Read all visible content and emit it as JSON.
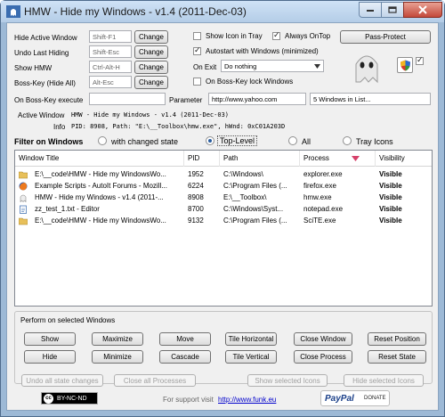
{
  "window": {
    "title": "HMW - Hide my Windows - v1.4 (2011-Dec-03)"
  },
  "hotkeys": [
    {
      "label": "Hide Active Window",
      "value": "Shift-F1",
      "button": "Change"
    },
    {
      "label": "Undo Last Hiding",
      "value": "Shift-Esc",
      "button": "Change"
    },
    {
      "label": "Show HMW",
      "value": "Ctrl-Alt-H",
      "button": "Change"
    },
    {
      "label": "Boss-Key (Hide All)",
      "value": "Alt-Esc",
      "button": "Change"
    }
  ],
  "options": {
    "show_icon_in_tray": {
      "label": "Show Icon in Tray",
      "checked": false
    },
    "always_on_top": {
      "label": "Always OnTop",
      "checked": true
    },
    "autostart": {
      "label": "Autostart with Windows (minimized)",
      "checked": true
    },
    "on_exit_label": "On Exit",
    "on_exit_value": "Do nothing",
    "boss_key_lock": {
      "label": "On Boss-Key lock Windows",
      "checked": false
    },
    "pass_protect": "Pass-Protect"
  },
  "boss_execute": {
    "label": "On Boss-Key execute",
    "value": "",
    "parameter_label": "Parameter",
    "parameter_value": "http://www.yahoo.com",
    "window_count": "5 Windows in List..."
  },
  "active_window": {
    "label": "Active Window",
    "value": "HMW - Hide my Windows - v1.4 (2011-Dec-03)",
    "info_label": "Info",
    "info_value": "PID: 8908, Path: \"E:\\__Toolbox\\hmw.exe\", hWnd: 0xC01A203D"
  },
  "filter": {
    "label": "Filter on Windows",
    "options": [
      "with changed state",
      "Top-Level",
      "All",
      "Tray Icons"
    ],
    "selected": "Top-Level"
  },
  "table": {
    "columns": [
      "Window Title",
      "PID",
      "Path",
      "Process",
      "Visibility"
    ],
    "rows": [
      {
        "icon": "folder-icon",
        "title": "E:\\__code\\HMW - Hide my WindowsWo...",
        "pid": "1952",
        "path": "C:\\Windows\\",
        "process": "explorer.exe",
        "visibility": "Visible"
      },
      {
        "icon": "firefox-icon",
        "title": "Example Scripts - AutoIt Forums - Mozill...",
        "pid": "6224",
        "path": "C:\\Program Files (...",
        "process": "firefox.exe",
        "visibility": "Visible"
      },
      {
        "icon": "ghost-icon",
        "title": "HMW - Hide my Windows - v1.4 (2011-...",
        "pid": "8908",
        "path": "E:\\__Toolbox\\",
        "process": "hmw.exe",
        "visibility": "Visible"
      },
      {
        "icon": "notepad-icon",
        "title": "zz_test_1.txt - Editor",
        "pid": "8700",
        "path": "C:\\Windows\\Syst...",
        "process": "notepad.exe",
        "visibility": "Visible"
      },
      {
        "icon": "scite-icon",
        "title": "E:\\__code\\HMW - Hide my WindowsWo...",
        "pid": "9132",
        "path": "C:\\Program Files (...",
        "process": "SciTE.exe",
        "visibility": "Visible"
      }
    ]
  },
  "actions": {
    "title": "Perform on selected Windows",
    "row1": [
      "Show",
      "Maximize",
      "Move",
      "Tile Horizontal",
      "Close Window",
      "Reset Position"
    ],
    "row2": [
      "Hide",
      "Minimize",
      "Cascade",
      "Tile Vertical",
      "Close Process",
      "Reset State"
    ]
  },
  "bottom": {
    "undo_all": "Undo all state changes",
    "close_all": "Close all Processes",
    "show_icons": "Show selected Icons",
    "hide_icons": "Hide selected Icons",
    "cc_license": "BY-NC-ND",
    "cc_mark": "cc",
    "support_text": "For support visit",
    "support_link": "http://www.funk.eu",
    "paypal": "PayPal",
    "donate": "DONATE"
  }
}
